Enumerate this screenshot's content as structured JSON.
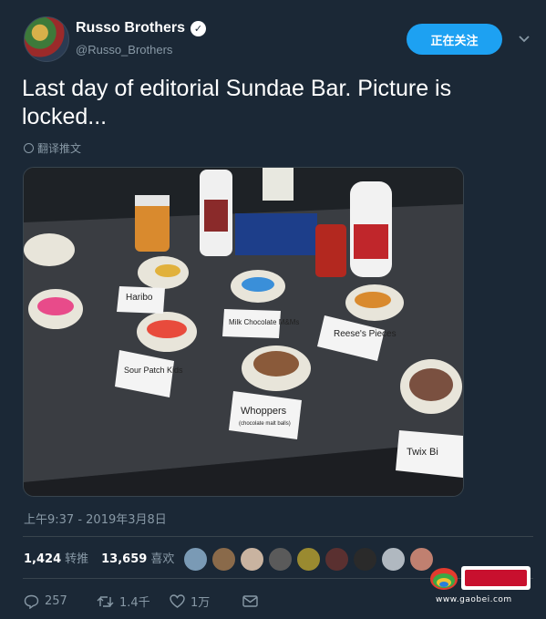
{
  "profile": {
    "display_name": "Russo Brothers",
    "handle": "@Russo_Brothers",
    "follow_button": "正在关注"
  },
  "tweet": {
    "text": "Last day of editorial Sundae Bar. Picture is locked...",
    "translate_label": "翻译推文",
    "timestamp": "上午9:37 - 2019年3月8日"
  },
  "photo": {
    "labels": {
      "haribo": "Haribo",
      "milk_choc": "Milk Chocolate M&Ms",
      "reeses": "Reese's Pieces",
      "sour_patch": "Sour Patch Kids",
      "whoppers": "Whoppers",
      "whoppers_sub": "(chocolate malt balls)",
      "twix": "Twix Bi"
    }
  },
  "stats": {
    "retweets_count": "1,424",
    "retweets_label": "转推",
    "likes_count": "13,659",
    "likes_label": "喜欢"
  },
  "actions": {
    "replies": "257",
    "retweets": "1.4千",
    "likes": "1万"
  },
  "watermark": {
    "url": "www.gaobei.com"
  },
  "colors": {
    "background": "#1b2836",
    "accent": "#1da1f2",
    "muted": "#8899a6",
    "divider": "#38444d"
  }
}
